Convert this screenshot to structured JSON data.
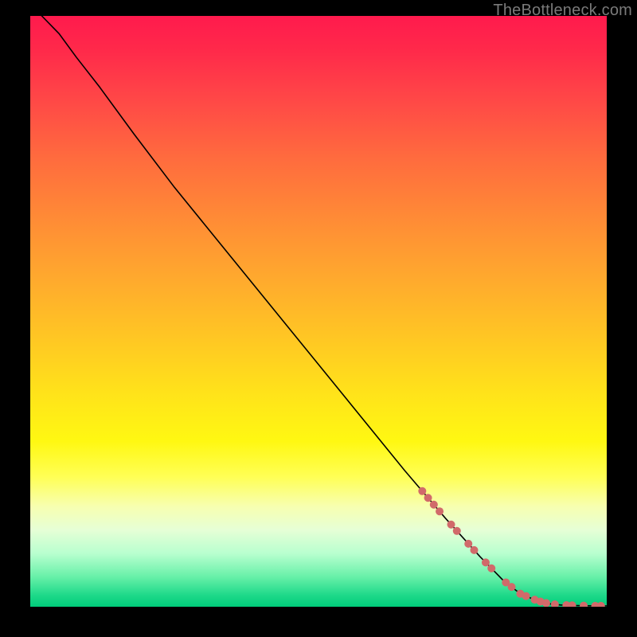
{
  "watermark": "TheBottleneck.com",
  "chart_data": {
    "type": "line",
    "title": "",
    "xlabel": "",
    "ylabel": "",
    "xlim": [
      0,
      100
    ],
    "ylim": [
      0,
      100
    ],
    "x": [
      0,
      2,
      5,
      8,
      12,
      18,
      25,
      35,
      45,
      55,
      65,
      72,
      78,
      82,
      85,
      88,
      90,
      92,
      95,
      98,
      100
    ],
    "y": [
      102,
      100,
      97,
      93,
      88,
      80,
      71,
      59,
      47,
      35,
      23,
      15,
      8.5,
      4.5,
      2.2,
      1.0,
      0.5,
      0.3,
      0.2,
      0.15,
      0.15
    ],
    "markers": {
      "note": "marker clusters along the curve tail (x positions, on-curve)",
      "x": [
        68,
        69,
        70,
        71,
        73,
        74,
        76,
        77,
        79,
        80,
        82.5,
        83.5,
        85,
        86,
        87.5,
        88.5,
        89.5,
        91,
        93,
        94,
        96,
        98,
        99
      ],
      "r": 5
    },
    "colors": {
      "line": "#000000",
      "marker": "#d16a6a"
    }
  }
}
